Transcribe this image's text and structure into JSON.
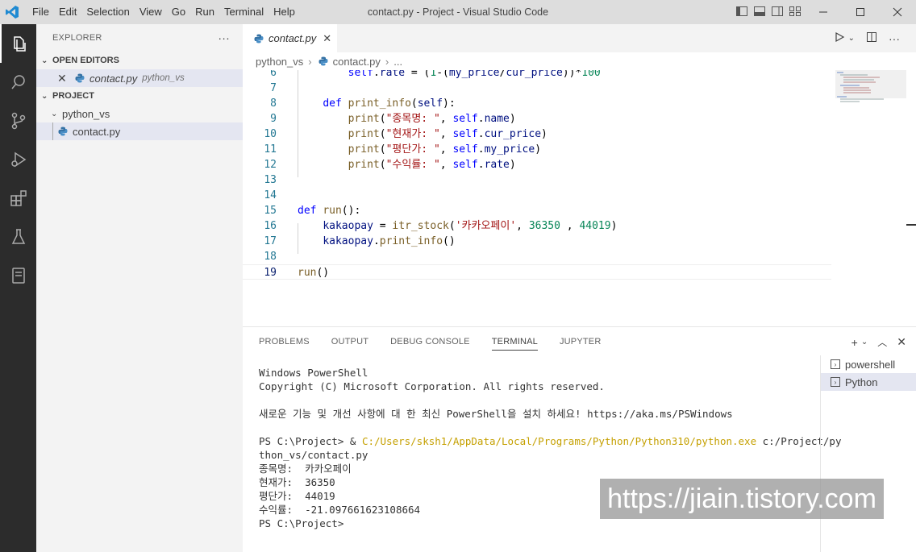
{
  "app": {
    "window_title": "contact.py - Project - Visual Studio Code",
    "menu": [
      "File",
      "Edit",
      "Selection",
      "View",
      "Go",
      "Run",
      "Terminal",
      "Help"
    ]
  },
  "sidebar": {
    "title": "EXPLORER",
    "open_editors_label": "OPEN EDITORS",
    "open_editor": {
      "name": "contact.py",
      "folder": "python_vs"
    },
    "project_label": "PROJECT",
    "folder": "python_vs",
    "file": "contact.py"
  },
  "editor": {
    "tab_label": "contact.py",
    "breadcrumb": [
      "python_vs",
      "contact.py",
      "..."
    ],
    "line_numbers": [
      "6",
      "7",
      "8",
      "9",
      "10",
      "11",
      "12",
      "13",
      "14",
      "15",
      "16",
      "17",
      "18",
      "19"
    ]
  },
  "panel": {
    "tabs": [
      "PROBLEMS",
      "OUTPUT",
      "DEBUG CONSOLE",
      "TERMINAL",
      "JUPYTER"
    ],
    "active_tab": "TERMINAL",
    "terminal_lines": [
      "Windows PowerShell",
      "Copyright (C) Microsoft Corporation. All rights reserved.",
      "",
      "새로운 기능 및 개선 사항에 대 한 최신 PowerShell을 설치 하세요! https://aka.ms/PSWindows",
      ""
    ],
    "prompt_prefix": "PS C:\\Project> & ",
    "python_exe_path": "C:/Users/sksh1/AppData/Local/Programs/Python/Python310/python.exe",
    "script_arg_part1": " c:/Project/py",
    "script_arg_part2": "thon_vs/contact.py",
    "output_lines": [
      "종목명:  카카오페이",
      "현재가:  36350",
      "평단가:  44019",
      "수익률:  -21.097661623108664",
      "PS C:\\Project>"
    ],
    "terminals": [
      "powershell",
      "Python"
    ],
    "selected_terminal": "Python"
  },
  "watermark": "https://jiain.tistory.com"
}
